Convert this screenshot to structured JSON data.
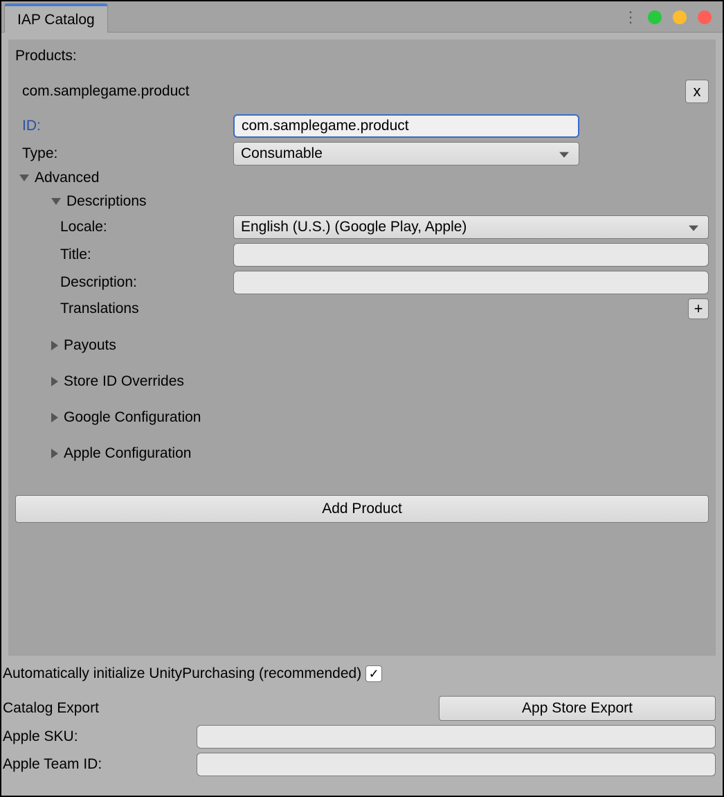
{
  "window": {
    "tab_title": "IAP Catalog"
  },
  "products": {
    "section_label": "Products:",
    "items": [
      {
        "name": "com.samplegame.product",
        "close_label": "x",
        "id_label": "ID:",
        "id_value": "com.samplegame.product",
        "type_label": "Type:",
        "type_value": "Consumable",
        "advanced": {
          "label": "Advanced",
          "descriptions": {
            "label": "Descriptions",
            "locale_label": "Locale:",
            "locale_value": "English (U.S.) (Google Play, Apple)",
            "title_label": "Title:",
            "title_value": "",
            "description_label": "Description:",
            "description_value": "",
            "translations_label": "Translations",
            "translations_add": "+"
          },
          "payouts_label": "Payouts",
          "store_overrides_label": "Store ID Overrides",
          "google_config_label": "Google Configuration",
          "apple_config_label": "Apple Configuration"
        }
      }
    ],
    "add_button": "Add Product"
  },
  "footer": {
    "auto_init_label": "Automatically initialize UnityPurchasing (recommended)",
    "auto_init_checked": "✓",
    "catalog_export_label": "Catalog Export",
    "app_store_export_button": "App Store Export",
    "apple_sku_label": "Apple SKU:",
    "apple_sku_value": "",
    "apple_team_id_label": "Apple Team ID:",
    "apple_team_id_value": ""
  }
}
